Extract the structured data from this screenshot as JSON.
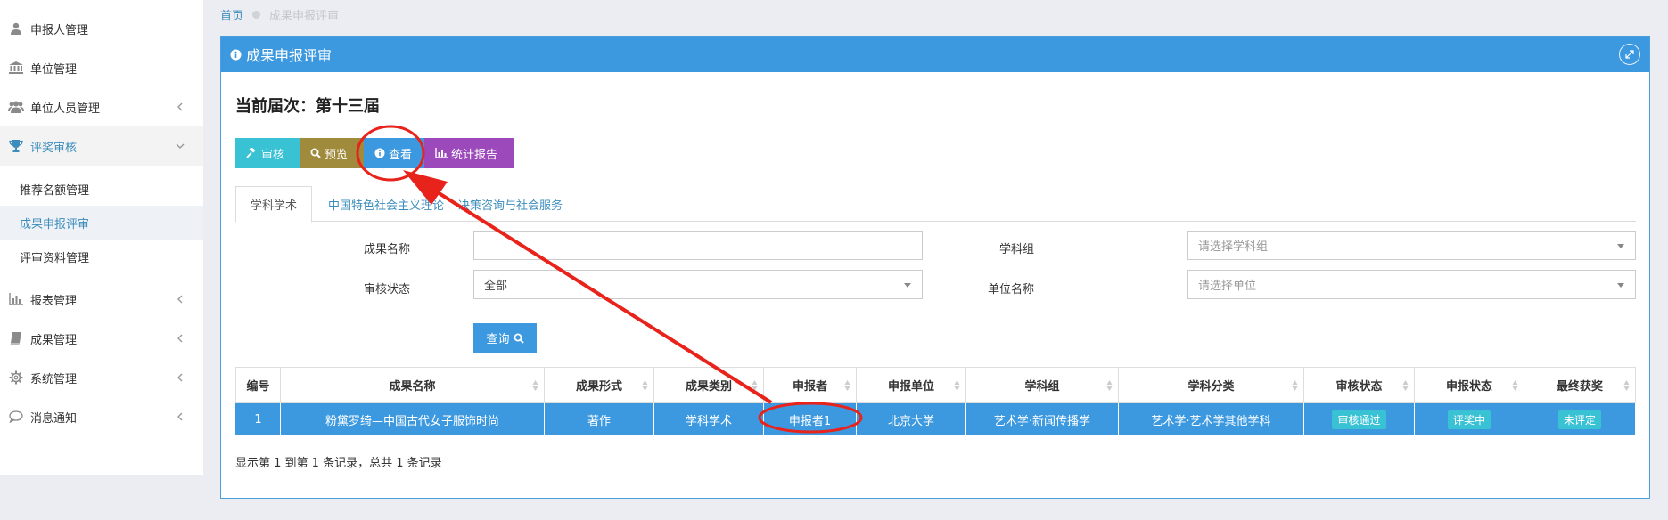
{
  "sidebar": {
    "items": [
      {
        "label": "申报人管理",
        "icon": "user-icon"
      },
      {
        "label": "单位管理",
        "icon": "institution-icon"
      },
      {
        "label": "单位人员管理",
        "icon": "users-icon"
      },
      {
        "label": "评奖审核",
        "icon": "trophy-icon"
      },
      {
        "label": "报表管理",
        "icon": "bar-chart-icon"
      },
      {
        "label": "成果管理",
        "icon": "book-icon"
      },
      {
        "label": "系统管理",
        "icon": "gear-icon"
      },
      {
        "label": "消息通知",
        "icon": "comment-icon"
      }
    ],
    "sub_items": [
      {
        "label": "推荐名额管理"
      },
      {
        "label": "成果申报评审"
      },
      {
        "label": "评审资料管理"
      }
    ]
  },
  "breadcrumb": {
    "home": "首页",
    "current": "成果申报评审"
  },
  "panel": {
    "title": "成果申报评审"
  },
  "session": {
    "label": "当前届次：第十三届"
  },
  "toolbar": {
    "review": "审核",
    "preview": "预览",
    "view": "查看",
    "stats": "统计报告"
  },
  "tabs": [
    {
      "label": "学科学术"
    },
    {
      "label": "中国特色社会主义理论"
    },
    {
      "label": "决策咨询与社会服务"
    }
  ],
  "filters": {
    "name_label": "成果名称",
    "name_value": "",
    "status_label": "审核状态",
    "status_value": "全部",
    "group_label": "学科组",
    "group_placeholder": "请选择学科组",
    "unit_label": "单位名称",
    "unit_placeholder": "请选择单位",
    "query_label": "查询"
  },
  "table": {
    "columns": [
      "编号",
      "成果名称",
      "成果形式",
      "成果类别",
      "申报者",
      "申报单位",
      "学科组",
      "学科分类",
      "审核状态",
      "申报状态",
      "最终获奖"
    ],
    "rows": [
      [
        "1",
        "粉黛罗绮—中国古代女子服饰时尚",
        "著作",
        "学科学术",
        "申报者1",
        "北京大学",
        "艺术学·新闻传播学",
        "艺术学·艺术学其他学科",
        "审核通过",
        "评奖中",
        "未评定"
      ]
    ],
    "footer": "显示第 1 到第 1 条记录，总共 1 条记录"
  },
  "colors": {
    "primary": "#3c99e0",
    "cyan": "#39c1d4",
    "olive": "#a08a3c",
    "purple": "#9b49bb",
    "annotation": "#e8231b"
  }
}
